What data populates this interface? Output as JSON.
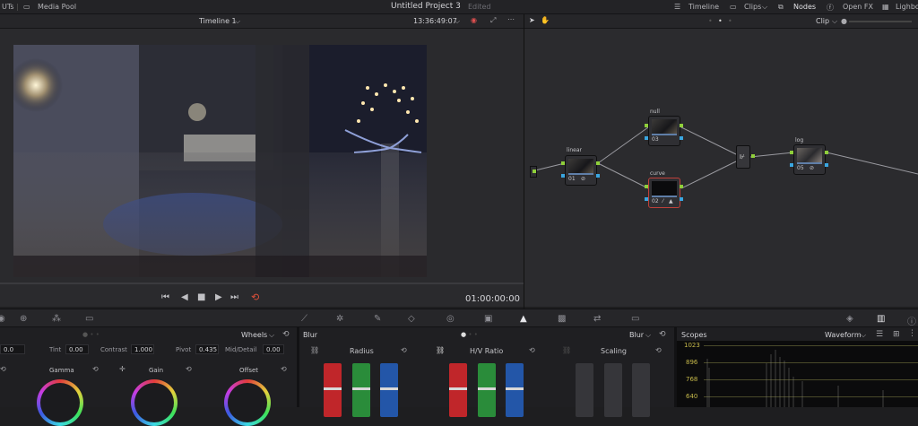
{
  "topbar": {
    "luts_label": "UTs",
    "media_pool": "Media Pool",
    "project_title": "Untitled Project 3",
    "edited": "Edited",
    "timeline_label": "Timeline",
    "clips_label": "Clips",
    "nodes_label": "Nodes",
    "openfx_label": "Open FX",
    "lightbox_label": "Lighbo"
  },
  "viewer": {
    "timeline_name": "Timeline 1",
    "timecode": "13:36:49:07",
    "playhead_timecode": "01:00:00:00"
  },
  "nodes_header": {
    "mode": "Clip"
  },
  "node_graph": {
    "nodes": [
      {
        "name": "linear",
        "number": "01"
      },
      {
        "name": "null",
        "number": "03"
      },
      {
        "name": "curve",
        "number": "02"
      },
      {
        "name": "log",
        "number": "05"
      }
    ]
  },
  "primaries": {
    "mode": "Wheels",
    "temp_value": "0.0",
    "tint_label": "Tint",
    "tint_value": "0.00",
    "contrast_label": "Contrast",
    "contrast_value": "1.000",
    "pivot_label": "Pivot",
    "pivot_value": "0.435",
    "middetail_label": "Mid/Detail",
    "middetail_value": "0.00",
    "gamma_label": "Gamma",
    "gain_label": "Gain",
    "offset_label": "Offset"
  },
  "blur": {
    "title": "Blur",
    "mode": "Blur",
    "radius_label": "Radius",
    "hv_label": "H/V Ratio",
    "scaling_label": "Scaling"
  },
  "scopes": {
    "title": "Scopes",
    "mode": "Waveform",
    "ticks": [
      "1023",
      "896",
      "768",
      "640"
    ]
  }
}
